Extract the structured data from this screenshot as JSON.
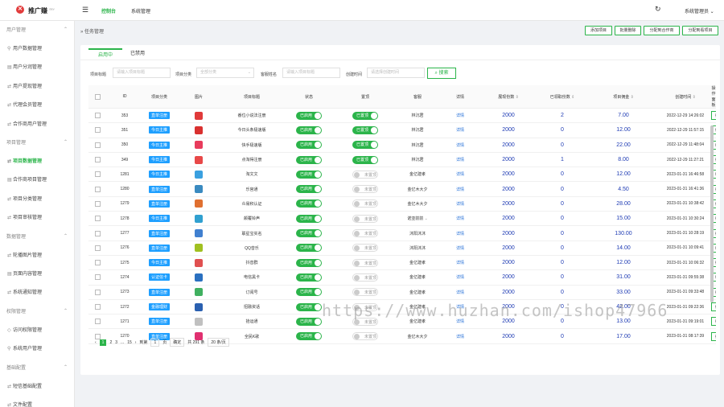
{
  "header": {
    "logo_glyph": "✕",
    "brand": "推广赚",
    "brand_sup": "dev",
    "menu_glyph": "☰",
    "nav": [
      "控制台",
      "系统管理"
    ],
    "refresh_glyph": "↻",
    "user": "系统管理员 ⌄"
  },
  "sidebar": {
    "groups": [
      {
        "label": "用户管理",
        "items": [
          {
            "icon": "user-icon",
            "label": "用户数据管理"
          },
          {
            "icon": "list-icon",
            "label": "用户分润管理"
          },
          {
            "icon": "link-icon",
            "label": "用户提现管理"
          },
          {
            "icon": "link-icon",
            "label": "代理会员管理"
          },
          {
            "icon": "link-icon",
            "label": "合作商用户管理"
          }
        ]
      },
      {
        "label": "项目管理",
        "items": [
          {
            "icon": "link-icon",
            "label": "项目数据管理",
            "active": true
          },
          {
            "icon": "list-icon",
            "label": "合作商项目管理"
          },
          {
            "icon": "link-icon",
            "label": "项目分类管理"
          },
          {
            "icon": "link-icon",
            "label": "项目审核管理"
          }
        ]
      },
      {
        "label": "数据管理",
        "items": [
          {
            "icon": "link-icon",
            "label": "轮播图片管理"
          },
          {
            "icon": "list-icon",
            "label": "页面内容管理"
          },
          {
            "icon": "link-icon",
            "label": "系统通知管理"
          }
        ]
      },
      {
        "label": "权限管理",
        "items": [
          {
            "icon": "shield-icon",
            "label": "访问权限管理"
          },
          {
            "icon": "user-icon",
            "label": "系统用户管理"
          }
        ]
      },
      {
        "label": "基础配置",
        "items": [
          {
            "icon": "link-icon",
            "label": "短信基础配置"
          },
          {
            "icon": "link-icon",
            "label": "文件配置"
          }
        ]
      }
    ]
  },
  "breadcrumb": "任务管理",
  "top_buttons": [
    "添加项目",
    "批量删除",
    "分配到合作商",
    "分配到看项目"
  ],
  "tabs": [
    "启用中",
    "已禁用"
  ],
  "filters": {
    "project_title_label": "项目标题",
    "project_title_placeholder": "请输入项目标题",
    "category_label": "项目分类",
    "category_value": "全部分类",
    "owner_label": "客服姓名",
    "owner_placeholder": "请输入项目标题",
    "created_label": "创建时间",
    "created_placeholder": "请选择创建时间",
    "search_label": "搜索"
  },
  "table": {
    "headers": [
      "ID",
      "项目分类",
      "图片",
      "项目标题",
      "状态",
      "置顶",
      "客服",
      "详情",
      "展现份数",
      "已领取份数",
      "项目佣金",
      "创建时间",
      "操作面板"
    ],
    "sort_headers": [
      "展现份数",
      "已领取份数",
      "项目佣金",
      "创建时间"
    ],
    "rows": [
      {
        "id": "353",
        "cat": "直单注册",
        "color": "#e03a3a",
        "title": "番位小说法注册",
        "on": true,
        "top": true,
        "owner": "林沉君",
        "detail": "详情",
        "shares": "2000",
        "taken": "2",
        "commission": "7.00",
        "time": "2022-12-29 14:26:02",
        "edit": "编辑"
      },
      {
        "id": "351",
        "cat": "今日主推",
        "color": "#d9302f",
        "title": "今日头条极速版",
        "on": true,
        "top": true,
        "owner": "林沉君",
        "detail": "详情",
        "shares": "2000",
        "taken": "0",
        "commission": "12.00",
        "time": "2022-12-29 11:57:15",
        "edit": "编辑"
      },
      {
        "id": "350",
        "cat": "今日主推",
        "color": "#e83c5c",
        "title": "快手极速版",
        "on": true,
        "top": true,
        "owner": "林沉君",
        "detail": "详情",
        "shares": "2000",
        "taken": "0",
        "commission": "22.00",
        "time": "2022-12-29 11:48:04",
        "edit": "编辑"
      },
      {
        "id": "349",
        "cat": "今日主推",
        "color": "#e84848",
        "title": "点淘得注册",
        "on": true,
        "top": true,
        "owner": "林沉君",
        "detail": "详情",
        "shares": "2000",
        "taken": "1",
        "commission": "8.00",
        "time": "2022-12-29 11:27:21",
        "edit": "编辑"
      },
      {
        "id": "1281",
        "cat": "今日主推",
        "color": "#3aa0e0",
        "title": "淘文文",
        "on": true,
        "top": false,
        "owner": "金亿建孝",
        "detail": "详情",
        "shares": "2000",
        "taken": "0",
        "commission": "12.00",
        "time": "2023-01-31 16:46:58",
        "edit": "编辑"
      },
      {
        "id": "1280",
        "cat": "直单注册",
        "color": "#3a8ac0",
        "title": "乐宫通",
        "on": true,
        "top": false,
        "owner": "金亿木大夕",
        "detail": "详情",
        "shares": "2000",
        "taken": "0",
        "commission": "4.50",
        "time": "2023-01-31 16:41:36",
        "edit": "编辑"
      },
      {
        "id": "1279",
        "cat": "直单注册",
        "color": "#e07030",
        "title": "众易积认证",
        "on": true,
        "top": false,
        "owner": "金亿木大夕",
        "detail": "详情",
        "shares": "2000",
        "taken": "0",
        "commission": "28.00",
        "time": "2023-01-31 10:38:42",
        "edit": "编辑"
      },
      {
        "id": "1278",
        "cat": "今日主推",
        "color": "#30a0d0",
        "title": "颠覆铃声",
        "on": true,
        "top": false,
        "owner": "诺亚前前",
        "detail": "详情",
        "shares": "2000",
        "taken": "0",
        "commission": "15.00",
        "time": "2023-01-31 10:30:24",
        "edit": "编辑",
        "chev": true
      },
      {
        "id": "1277",
        "cat": "直单注册",
        "color": "#4080d0",
        "title": "联星宝实名",
        "on": true,
        "top": false,
        "owner": "沐阳沐沐",
        "detail": "详情",
        "shares": "2000",
        "taken": "0",
        "commission": "130.00",
        "time": "2023-01-31 10:28:19",
        "edit": "编辑"
      },
      {
        "id": "1276",
        "cat": "直单注册",
        "color": "#a0c020",
        "title": "QQ音乐",
        "on": true,
        "top": false,
        "owner": "沐阳沐沐",
        "detail": "详情",
        "shares": "2000",
        "taken": "0",
        "commission": "14.00",
        "time": "2023-01-31 10:09:41",
        "edit": "编辑"
      },
      {
        "id": "1275",
        "cat": "今日主推",
        "color": "#e05050",
        "title": "抖音群",
        "on": true,
        "top": false,
        "owner": "金亿建孝",
        "detail": "详情",
        "shares": "2000",
        "taken": "0",
        "commission": "12.00",
        "time": "2023-01-31 10:06:32",
        "edit": "编辑"
      },
      {
        "id": "1274",
        "cat": "认证信卡",
        "color": "#2a70c0",
        "title": "电信黑卡",
        "on": true,
        "top": false,
        "owner": "金亿建孝",
        "detail": "详情",
        "shares": "2000",
        "taken": "0",
        "commission": "31.00",
        "time": "2023-01-31 09:55:38",
        "edit": "编辑"
      },
      {
        "id": "1273",
        "cat": "直单注册",
        "color": "#40b060",
        "title": "订阅号",
        "on": true,
        "top": false,
        "owner": "金亿建孝",
        "detail": "详情",
        "shares": "2000",
        "taken": "0",
        "commission": "33.00",
        "time": "2023-01-31 09:33:48",
        "edit": "编辑"
      },
      {
        "id": "1272",
        "cat": "金融理财",
        "color": "#2a60b0",
        "title": "招融资话",
        "on": true,
        "top": false,
        "owner": "金亿建孝",
        "detail": "详情",
        "shares": "2000",
        "taken": "0",
        "commission": "42.00",
        "time": "2023-01-31 09:22:36",
        "edit": "编辑"
      },
      {
        "id": "1271",
        "cat": "直单注册",
        "color": "#c0c0c0",
        "title": "拾运通",
        "on": true,
        "top": false,
        "owner": "金亿建孝",
        "detail": "详情",
        "shares": "2000",
        "taken": "0",
        "commission": "13.00",
        "time": "2023-01-31 09:19:01",
        "edit": "编辑"
      },
      {
        "id": "1270",
        "cat": "直单注册",
        "color": "#e03070",
        "title": "全民K歌",
        "on": true,
        "top": false,
        "owner": "金亿木大夕",
        "detail": "详情",
        "shares": "2000",
        "taken": "0",
        "commission": "17.00",
        "time": "2023-01-31 08:17:39",
        "edit": "编辑"
      }
    ],
    "on_label": "已启用",
    "top_on_label": "已置顶",
    "top_off_label": "未置顶"
  },
  "pagination": {
    "prev": "‹",
    "pages": [
      "1",
      "2",
      "3",
      "...",
      "15"
    ],
    "next": "›",
    "goto_label": "到第",
    "goto_value": "1",
    "page_suffix": "页",
    "confirm": "确定",
    "total": "共 291 条",
    "size": "20 条/页"
  },
  "watermark": "https://www.huzhan.com/ishop47966",
  "colors": {
    "accent": "#2bb44a",
    "tag": "#1e9fff",
    "number": "#1e3bb4"
  }
}
